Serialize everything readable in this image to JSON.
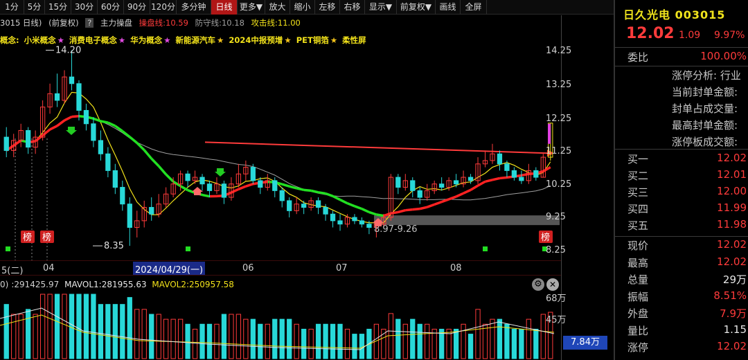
{
  "toolbar": {
    "items": [
      "1分",
      "5分",
      "15分",
      "30分",
      "60分",
      "90分",
      "120分",
      "多分钟",
      "日线",
      "更多▼",
      "放大",
      "缩小",
      "左移",
      "右移",
      "显示▼",
      "前复权▼",
      "画线",
      "全屏"
    ],
    "active": "日线"
  },
  "info_bar": {
    "code_period": "3015 日线)",
    "adjust": "(前复权)",
    "help": "?",
    "main_ctrl": "主力操盘",
    "ctrl_line": "操盘线:10.59",
    "defend_line": "防守线:10.18",
    "attack_line": "攻击线:11.00"
  },
  "concept_bar": {
    "prefix": "概念:",
    "items": [
      {
        "name": "小米概念",
        "star": "★"
      },
      {
        "name": "消费电子概念",
        "star": "★"
      },
      {
        "name": "华为概念",
        "star": "★"
      },
      {
        "name": "新能源汽车",
        "star": "★"
      },
      {
        "name": "2024中报预增",
        "star": "★"
      },
      {
        "name": "PET铜箔",
        "star": "★"
      },
      {
        "name": "柔性屏",
        "star": ""
      }
    ]
  },
  "price_axis": [
    "14.25",
    "13.25",
    "12.25",
    "11.25",
    "10.25",
    "9.25",
    "8.25"
  ],
  "annotations": {
    "high": "14.20",
    "low": "8.35",
    "gap_zone": "8.97-9.26",
    "rank_badge": "榜"
  },
  "date_bar": {
    "labels": [
      "5(二)",
      "04",
      "06",
      "07",
      "08"
    ],
    "selected": "2024/04/29(一)"
  },
  "volume": {
    "header_prefix": "0)",
    "vol": ":291425.97",
    "mavol1": "MAVOL1:281955.63",
    "mavol2": "MAVOL2:250957.58",
    "axis": [
      "68万",
      "45万"
    ],
    "current": "7.84万"
  },
  "right_panel": {
    "name": "日久光电 003015",
    "price": "12.02",
    "change": "1.09",
    "pct": "9.97%",
    "weibi_label": "委比",
    "weibi_value": "100.00%",
    "limit_rows": [
      "涨停分析: 行业",
      "当前封单金额:",
      "封单占成交量:",
      "最高封单金额:",
      "涨停板成交额:"
    ],
    "bids": [
      {
        "label": "买一",
        "price": "12.02"
      },
      {
        "label": "买二",
        "price": "12.01"
      },
      {
        "label": "买三",
        "price": "12.00"
      },
      {
        "label": "买四",
        "price": "11.99"
      },
      {
        "label": "买五",
        "price": "11.98"
      }
    ],
    "stats": [
      {
        "label": "现价",
        "value": "12.02",
        "color": "red"
      },
      {
        "label": "最高",
        "value": "12.02",
        "color": "red"
      },
      {
        "label": "总量",
        "value": "29万",
        "color": "white"
      },
      {
        "label": "振幅",
        "value": "8.51%",
        "color": "red"
      },
      {
        "label": "外盘",
        "value": "7.9万",
        "color": "red"
      },
      {
        "label": "量比",
        "value": "1.15",
        "color": "white"
      },
      {
        "label": "涨停",
        "value": "12.02",
        "color": "red"
      }
    ]
  },
  "colors": {
    "up": "#ff3b3b",
    "down": "#28d8d8",
    "ma_main_up": "#ff2222",
    "ma_main_down": "#22e022",
    "ma_yellow": "#f2e21a",
    "ma_gray": "#a0a0a0"
  },
  "chart_data": {
    "type": "candlestick",
    "y_range": [
      8.0,
      14.5
    ],
    "candles": [
      [
        11.6,
        11.2,
        11.9,
        11.0
      ],
      [
        11.2,
        11.5,
        11.7,
        11.0
      ],
      [
        11.5,
        11.8,
        12.0,
        11.3
      ],
      [
        11.8,
        11.3,
        11.9,
        11.1
      ],
      [
        11.3,
        11.6,
        11.8,
        11.1
      ],
      [
        11.6,
        12.5,
        12.7,
        11.5
      ],
      [
        12.5,
        12.9,
        13.2,
        12.3
      ],
      [
        12.9,
        12.7,
        13.5,
        12.5
      ],
      [
        12.7,
        13.4,
        13.6,
        12.6
      ],
      [
        13.4,
        13.2,
        14.2,
        13.0
      ],
      [
        13.2,
        12.4,
        13.3,
        12.1
      ],
      [
        12.4,
        12.0,
        12.6,
        11.8
      ],
      [
        12.0,
        11.5,
        12.2,
        11.3
      ],
      [
        11.5,
        11.1,
        11.8,
        10.9
      ],
      [
        11.1,
        10.6,
        11.3,
        10.4
      ],
      [
        10.6,
        10.1,
        10.8,
        9.9
      ],
      [
        10.1,
        9.6,
        10.3,
        9.4
      ],
      [
        9.6,
        8.9,
        9.8,
        8.35
      ],
      [
        8.9,
        9.1,
        9.4,
        8.6
      ],
      [
        9.1,
        9.5,
        9.7,
        8.9
      ],
      [
        9.5,
        9.3,
        9.8,
        9.1
      ],
      [
        9.3,
        9.6,
        9.9,
        9.2
      ],
      [
        9.6,
        9.9,
        10.1,
        9.5
      ],
      [
        9.9,
        10.2,
        10.4,
        9.8
      ],
      [
        10.2,
        10.5,
        10.6,
        10.0
      ],
      [
        10.5,
        10.3,
        10.6,
        10.1
      ],
      [
        10.3,
        10.4,
        10.6,
        10.2
      ],
      [
        10.4,
        10.2,
        10.5,
        10.0
      ],
      [
        10.2,
        10.0,
        10.3,
        9.8
      ],
      [
        10.0,
        10.2,
        10.4,
        9.9
      ],
      [
        10.2,
        9.8,
        10.3,
        9.6
      ],
      [
        9.8,
        10.2,
        10.4,
        9.7
      ],
      [
        10.2,
        10.5,
        10.8,
        10.1
      ],
      [
        10.5,
        10.7,
        10.9,
        10.3
      ],
      [
        10.7,
        10.3,
        10.8,
        10.2
      ],
      [
        10.3,
        10.1,
        10.4,
        9.9
      ],
      [
        10.1,
        10.3,
        10.5,
        10.0
      ],
      [
        10.3,
        10.0,
        10.4,
        9.8
      ],
      [
        10.0,
        9.7,
        10.1,
        9.5
      ],
      [
        9.7,
        9.4,
        9.8,
        9.2
      ],
      [
        9.4,
        9.6,
        9.8,
        9.3
      ],
      [
        9.6,
        9.5,
        9.7,
        9.3
      ],
      [
        9.5,
        9.7,
        9.8,
        9.4
      ],
      [
        9.7,
        9.5,
        9.8,
        9.3
      ],
      [
        9.5,
        9.3,
        9.6,
        9.1
      ],
      [
        9.3,
        9.1,
        9.4,
        8.9
      ],
      [
        9.1,
        9.0,
        9.3,
        8.8
      ],
      [
        9.0,
        9.2,
        9.3,
        8.9
      ],
      [
        9.2,
        9.1,
        9.3,
        9.0
      ],
      [
        9.1,
        9.0,
        9.2,
        8.9
      ],
      [
        9.0,
        8.9,
        9.1,
        8.7
      ],
      [
        8.9,
        9.0,
        9.1,
        8.6
      ],
      [
        9.0,
        9.2,
        9.3,
        8.9
      ],
      [
        9.2,
        10.4,
        10.5,
        9.1
      ],
      [
        10.4,
        10.1,
        10.5,
        9.9
      ],
      [
        10.1,
        10.3,
        10.5,
        10.0
      ],
      [
        10.3,
        10.0,
        10.4,
        9.8
      ],
      [
        10.0,
        9.8,
        10.1,
        9.6
      ],
      [
        9.8,
        10.0,
        10.2,
        9.7
      ],
      [
        10.0,
        10.2,
        10.3,
        9.9
      ],
      [
        10.2,
        10.1,
        10.4,
        10.0
      ],
      [
        10.1,
        10.3,
        10.4,
        10.0
      ],
      [
        10.3,
        10.2,
        10.5,
        10.1
      ],
      [
        10.2,
        10.4,
        10.6,
        10.1
      ],
      [
        10.4,
        10.3,
        10.5,
        10.2
      ],
      [
        10.3,
        10.8,
        11.0,
        10.2
      ],
      [
        10.8,
        10.9,
        11.2,
        10.7
      ],
      [
        10.9,
        11.1,
        11.4,
        10.8
      ],
      [
        11.1,
        10.8,
        11.2,
        10.6
      ],
      [
        10.8,
        10.6,
        10.9,
        10.4
      ],
      [
        10.6,
        10.4,
        10.7,
        10.3
      ],
      [
        10.4,
        10.3,
        10.6,
        10.2
      ],
      [
        10.3,
        10.6,
        10.8,
        10.2
      ],
      [
        10.6,
        10.4,
        10.7,
        10.3
      ],
      [
        10.4,
        11.0,
        11.1,
        10.4
      ],
      [
        11.0,
        12.02,
        12.02,
        10.9
      ]
    ]
  }
}
